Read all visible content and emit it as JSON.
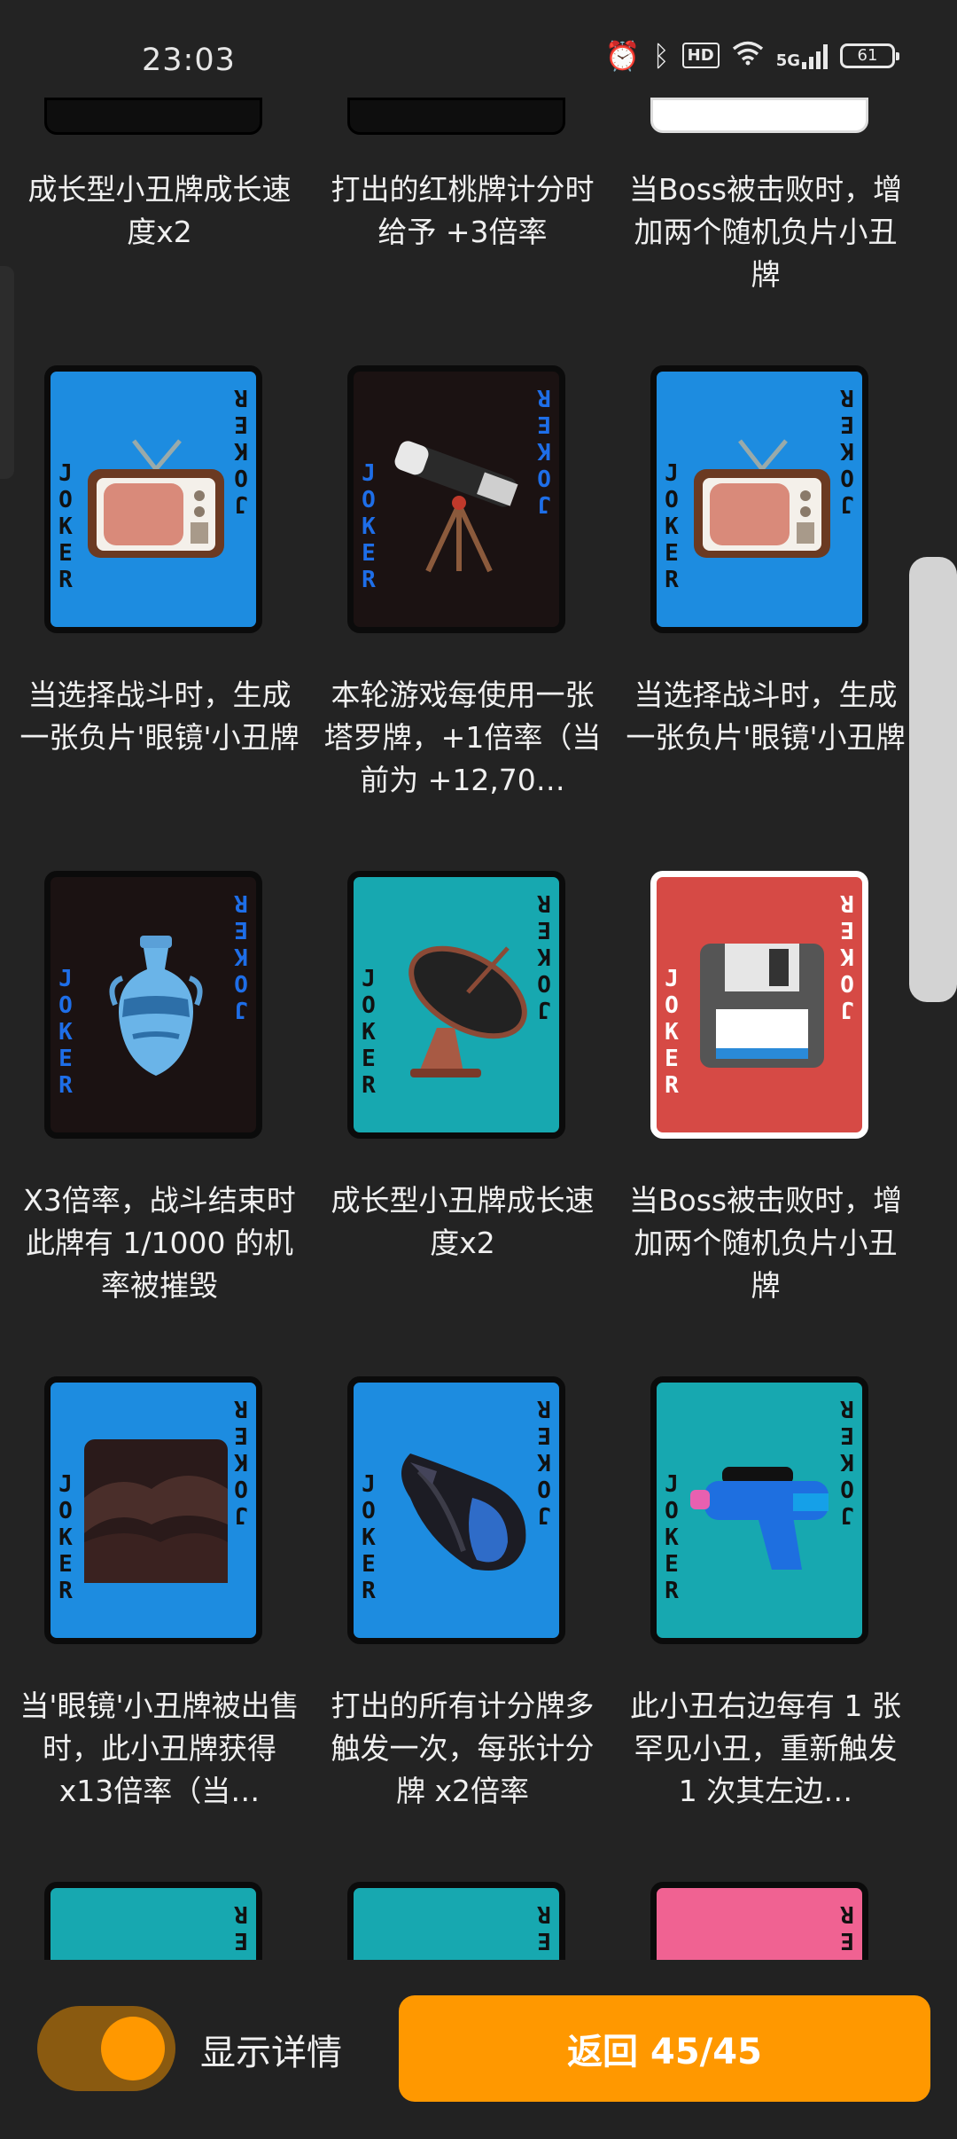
{
  "status_bar": {
    "time": "23:03",
    "icons": [
      "alarm-icon",
      "bluetooth-icon",
      "hd-icon",
      "wifi-icon",
      "5g-signal-icon",
      "battery-icon"
    ],
    "hd_label": "HD",
    "network_label": "5G",
    "battery": "61"
  },
  "grid": {
    "row0_desc": [
      "成长型小丑牌成长速度x2",
      "打出的红桃牌计分时给予 +3倍率",
      "当Boss被击败时，增加两个随机负片小丑牌"
    ],
    "rows": [
      {
        "cards": [
          {
            "joker_text": "JOKER",
            "bg": "#1d8ce0",
            "text_color": "#111",
            "icon": "tv-icon",
            "desc": "当选择战斗时，生成一张负片'眼镜'小丑牌"
          },
          {
            "joker_text": "JOKER",
            "bg": "#1b1212",
            "text_color": "#1e6ee8",
            "icon": "telescope-icon",
            "desc": "本轮游戏每使用一张塔罗牌，+1倍率（当前为 +12,70…"
          },
          {
            "joker_text": "JOKER",
            "bg": "#1d8ce0",
            "text_color": "#111",
            "icon": "tv-icon",
            "desc": "当选择战斗时，生成一张负片'眼镜'小丑牌"
          }
        ]
      },
      {
        "cards": [
          {
            "joker_text": "JOKER",
            "bg": "#1b1212",
            "text_color": "#1e6ee8",
            "icon": "vase-icon",
            "desc": "X3倍率，战斗结束时此牌有 1/1000 的机率被摧毁"
          },
          {
            "joker_text": "JOKER",
            "bg": "#17a8b0",
            "text_color": "#111",
            "icon": "satellite-dish-icon",
            "desc": "成长型小丑牌成长速度x2"
          },
          {
            "joker_text": "JOKER",
            "bg": "#d64a45",
            "text_color": "#fff",
            "icon": "floppy-disk-icon",
            "desc": "当Boss被击败时，增加两个随机负片小丑牌"
          }
        ]
      },
      {
        "cards": [
          {
            "joker_text": "JOKER",
            "bg": "#1d8ce0",
            "text_color": "#111",
            "icon": "dark-clouds-icon",
            "desc": "当'眼镜'小丑牌被出售时，此小丑牌获得 x13倍率（当…"
          },
          {
            "joker_text": "JOKER",
            "bg": "#1d8ce0",
            "text_color": "#111",
            "icon": "spiral-shell-icon",
            "desc": "打出的所有计分牌多触发一次，每张计分牌 x2倍率"
          },
          {
            "joker_text": "JOKER",
            "bg": "#17a8b0",
            "text_color": "#111",
            "icon": "water-pistol-icon",
            "desc": "此小丑右边每有 1 张罕见小丑，重新触发 1 次其左边…"
          }
        ]
      },
      {
        "cards": [
          {
            "joker_text": "JOKER",
            "bg": "#17a8b0",
            "text_color": "#111",
            "icon": "blank-icon"
          },
          {
            "joker_text": "JOKER",
            "bg": "#17a8b0",
            "text_color": "#111",
            "icon": "blank-icon"
          },
          {
            "joker_text": "JOKER",
            "bg": "#f06292",
            "text_color": "#111",
            "icon": "cloud-icon"
          }
        ]
      }
    ]
  },
  "bottom": {
    "toggle_label": "显示详情",
    "toggle_on": true,
    "back_label": "返回 45/45"
  }
}
